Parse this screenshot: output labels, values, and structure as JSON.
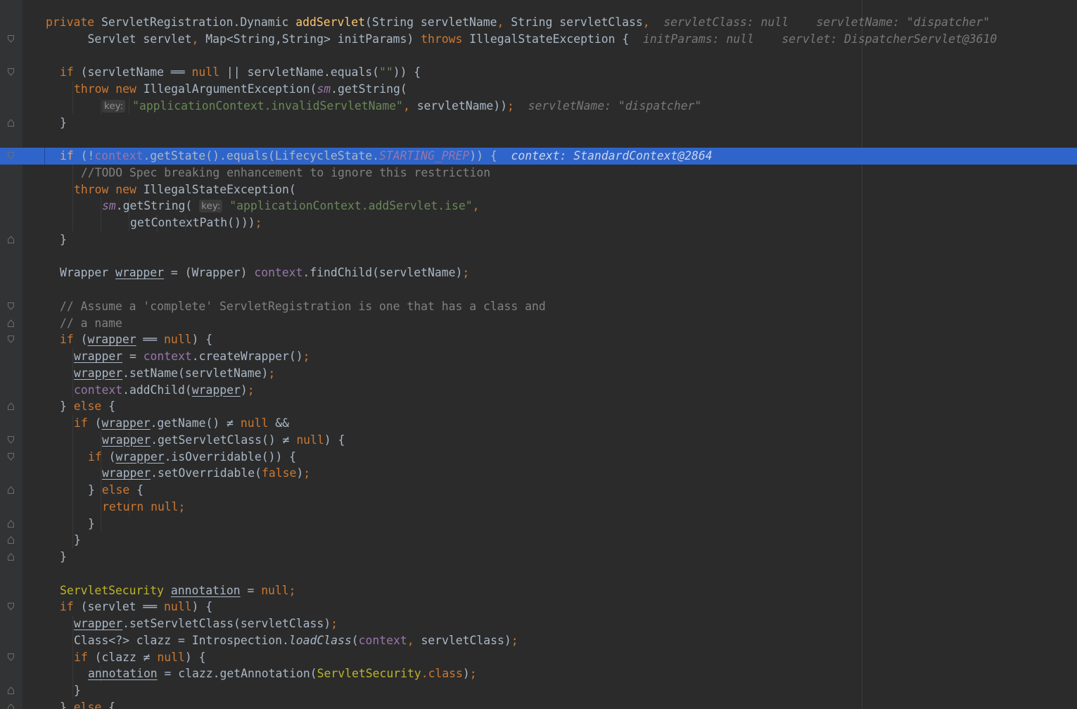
{
  "editor": {
    "language": "java",
    "colors": {
      "background": "#2b2b2b",
      "gutter": "#313335",
      "execution_line": "#2f65ca",
      "keyword": "#cc7832",
      "function": "#ffc66d",
      "string": "#6a8759",
      "field": "#9876aa",
      "comment": "#808080",
      "annotation": "#bbb529",
      "inline_hint": "#787878"
    },
    "icons": {
      "fold_open": "fold-open-icon",
      "fold_close": "fold-close-icon"
    },
    "lines": [
      {
        "indent": 0,
        "fold": "",
        "hl": false,
        "tokens": [
          {
            "t": "private ",
            "c": "kw"
          },
          {
            "t": "ServletRegistration.Dynamic "
          },
          {
            "t": "addServlet",
            "c": "fn"
          },
          {
            "t": "(String servletName"
          },
          {
            "t": ", ",
            "c": "kw"
          },
          {
            "t": "String servletClass"
          },
          {
            "t": ",",
            "c": "kw"
          },
          {
            "t": "  servletClass: null    servletName: \"dispatcher\"",
            "c": "hint"
          }
        ]
      },
      {
        "indent": 1,
        "fold": "open",
        "hl": false,
        "tokens": [
          {
            "t": "    Servlet servlet"
          },
          {
            "t": ", ",
            "c": "kw"
          },
          {
            "t": "Map<String,String> initParams) "
          },
          {
            "t": "throws ",
            "c": "kw"
          },
          {
            "t": "IllegalStateException {"
          },
          {
            "t": "  initParams: null    servlet: DispatcherServlet@3610",
            "c": "hint"
          }
        ]
      },
      {
        "indent": 0,
        "fold": "",
        "hl": false,
        "tokens": []
      },
      {
        "indent": 1,
        "fold": "open",
        "hl": false,
        "tokens": [
          {
            "t": "if ",
            "c": "kw"
          },
          {
            "t": "(servletName ══ "
          },
          {
            "t": "null ",
            "c": "kw"
          },
          {
            "t": "|| servletName.equals("
          },
          {
            "t": "\"\"",
            "c": "str"
          },
          {
            "t": ")) {"
          }
        ]
      },
      {
        "indent": 2,
        "fold": "",
        "hl": false,
        "tokens": [
          {
            "t": "throw new ",
            "c": "kw"
          },
          {
            "t": "IllegalArgumentException("
          },
          {
            "t": "sm",
            "c": "fld it"
          },
          {
            "t": ".getString("
          }
        ]
      },
      {
        "indent": 4,
        "fold": "",
        "hl": false,
        "tokens": [
          {
            "t": "key:",
            "c": "chip"
          },
          {
            "t": " "
          },
          {
            "t": "\"applicationContext.invalidServletName\"",
            "c": "str"
          },
          {
            "t": ", ",
            "c": "kw"
          },
          {
            "t": "servletName))"
          },
          {
            "t": ";",
            "c": "kw"
          },
          {
            "t": "  servletName: \"dispatcher\"",
            "c": "hint"
          }
        ]
      },
      {
        "indent": 1,
        "fold": "close",
        "hl": false,
        "tokens": [
          {
            "t": "}"
          }
        ]
      },
      {
        "indent": 0,
        "fold": "",
        "hl": false,
        "tokens": []
      },
      {
        "indent": 1,
        "fold": "open",
        "hl": true,
        "tokens": [
          {
            "t": "if ",
            "c": "kw"
          },
          {
            "t": "(!"
          },
          {
            "t": "context",
            "c": "fld"
          },
          {
            "t": ".getState().equals(LifecycleState."
          },
          {
            "t": "STARTING_PREP",
            "c": "fld it"
          },
          {
            "t": ")) {"
          },
          {
            "t": "  context: StandardContext@2864",
            "c": "hint"
          }
        ]
      },
      {
        "indent": 2,
        "fold": "",
        "hl": false,
        "tokens": [
          {
            "t": " //TODO Spec breaking enhancement to ignore this restriction",
            "c": "cm"
          }
        ]
      },
      {
        "indent": 2,
        "fold": "",
        "hl": false,
        "tokens": [
          {
            "t": "throw new ",
            "c": "kw"
          },
          {
            "t": "IllegalStateException("
          }
        ]
      },
      {
        "indent": 4,
        "fold": "",
        "hl": false,
        "tokens": [
          {
            "t": "sm",
            "c": "fld it"
          },
          {
            "t": ".getString( "
          },
          {
            "t": "key:",
            "c": "chip"
          },
          {
            "t": " "
          },
          {
            "t": "\"applicationContext.addServlet.ise\"",
            "c": "str"
          },
          {
            "t": ",",
            "c": "kw"
          }
        ]
      },
      {
        "indent": 6,
        "fold": "",
        "hl": false,
        "tokens": [
          {
            "t": "getContextPath()))"
          },
          {
            "t": ";",
            "c": "kw"
          }
        ]
      },
      {
        "indent": 1,
        "fold": "close",
        "hl": false,
        "tokens": [
          {
            "t": "}"
          }
        ]
      },
      {
        "indent": 0,
        "fold": "",
        "hl": false,
        "tokens": []
      },
      {
        "indent": 1,
        "fold": "",
        "hl": false,
        "tokens": [
          {
            "t": "Wrapper "
          },
          {
            "t": "wrapper",
            "c": "ul"
          },
          {
            "t": " = (Wrapper) "
          },
          {
            "t": "context",
            "c": "fld"
          },
          {
            "t": ".findChild(servletName)"
          },
          {
            "t": ";",
            "c": "kw"
          }
        ]
      },
      {
        "indent": 0,
        "fold": "",
        "hl": false,
        "tokens": []
      },
      {
        "indent": 1,
        "fold": "open",
        "hl": false,
        "tokens": [
          {
            "t": "// Assume a 'complete' ServletRegistration is one that has a class and",
            "c": "cm"
          }
        ]
      },
      {
        "indent": 1,
        "fold": "close",
        "hl": false,
        "tokens": [
          {
            "t": "// a name",
            "c": "cm"
          }
        ]
      },
      {
        "indent": 1,
        "fold": "open",
        "hl": false,
        "tokens": [
          {
            "t": "if ",
            "c": "kw"
          },
          {
            "t": "("
          },
          {
            "t": "wrapper",
            "c": "ul"
          },
          {
            "t": " ══ "
          },
          {
            "t": "null",
            "c": "kw"
          },
          {
            "t": ") {"
          }
        ]
      },
      {
        "indent": 2,
        "fold": "",
        "hl": false,
        "tokens": [
          {
            "t": "wrapper",
            "c": "ul"
          },
          {
            "t": " = "
          },
          {
            "t": "context",
            "c": "fld"
          },
          {
            "t": ".createWrapper()"
          },
          {
            "t": ";",
            "c": "kw"
          }
        ]
      },
      {
        "indent": 2,
        "fold": "",
        "hl": false,
        "tokens": [
          {
            "t": "wrapper",
            "c": "ul"
          },
          {
            "t": ".setName(servletName)"
          },
          {
            "t": ";",
            "c": "kw"
          }
        ]
      },
      {
        "indent": 2,
        "fold": "",
        "hl": false,
        "tokens": [
          {
            "t": "context",
            "c": "fld"
          },
          {
            "t": ".addChild("
          },
          {
            "t": "wrapper",
            "c": "ul"
          },
          {
            "t": ")"
          },
          {
            "t": ";",
            "c": "kw"
          }
        ]
      },
      {
        "indent": 1,
        "fold": "close",
        "hl": false,
        "tokens": [
          {
            "t": "} "
          },
          {
            "t": "else ",
            "c": "kw"
          },
          {
            "t": "{"
          }
        ]
      },
      {
        "indent": 2,
        "fold": "",
        "hl": false,
        "tokens": [
          {
            "t": "if ",
            "c": "kw"
          },
          {
            "t": "("
          },
          {
            "t": "wrapper",
            "c": "ul"
          },
          {
            "t": ".getName() ≠ "
          },
          {
            "t": "null ",
            "c": "kw"
          },
          {
            "t": "&&"
          }
        ]
      },
      {
        "indent": 4,
        "fold": "open",
        "hl": false,
        "tokens": [
          {
            "t": "wrapper",
            "c": "ul"
          },
          {
            "t": ".getServletClass() ≠ "
          },
          {
            "t": "null",
            "c": "kw"
          },
          {
            "t": ") {"
          }
        ]
      },
      {
        "indent": 3,
        "fold": "open",
        "hl": false,
        "tokens": [
          {
            "t": "if ",
            "c": "kw"
          },
          {
            "t": "("
          },
          {
            "t": "wrapper",
            "c": "ul"
          },
          {
            "t": ".isOverridable()) {"
          }
        ]
      },
      {
        "indent": 4,
        "fold": "",
        "hl": false,
        "tokens": [
          {
            "t": "wrapper",
            "c": "ul"
          },
          {
            "t": ".setOverridable("
          },
          {
            "t": "false",
            "c": "kw"
          },
          {
            "t": ")"
          },
          {
            "t": ";",
            "c": "kw"
          }
        ]
      },
      {
        "indent": 3,
        "fold": "close",
        "hl": false,
        "tokens": [
          {
            "t": "} "
          },
          {
            "t": "else ",
            "c": "kw"
          },
          {
            "t": "{"
          }
        ]
      },
      {
        "indent": 4,
        "fold": "",
        "hl": false,
        "tokens": [
          {
            "t": "return null;",
            "c": "kw"
          }
        ]
      },
      {
        "indent": 3,
        "fold": "close",
        "hl": false,
        "tokens": [
          {
            "t": "}"
          }
        ]
      },
      {
        "indent": 2,
        "fold": "close",
        "hl": false,
        "tokens": [
          {
            "t": "}"
          }
        ]
      },
      {
        "indent": 1,
        "fold": "close",
        "hl": false,
        "tokens": [
          {
            "t": "}"
          }
        ]
      },
      {
        "indent": 0,
        "fold": "",
        "hl": false,
        "tokens": []
      },
      {
        "indent": 1,
        "fold": "",
        "hl": false,
        "tokens": [
          {
            "t": "ServletSecurity ",
            "c": "ann"
          },
          {
            "t": "annotation",
            "c": "ul"
          },
          {
            "t": " = "
          },
          {
            "t": "null;",
            "c": "kw"
          }
        ]
      },
      {
        "indent": 1,
        "fold": "open",
        "hl": false,
        "tokens": [
          {
            "t": "if ",
            "c": "kw"
          },
          {
            "t": "(servlet ══ "
          },
          {
            "t": "null",
            "c": "kw"
          },
          {
            "t": ") {"
          }
        ]
      },
      {
        "indent": 2,
        "fold": "",
        "hl": false,
        "tokens": [
          {
            "t": "wrapper",
            "c": "ul"
          },
          {
            "t": ".setServletClass(servletClass)"
          },
          {
            "t": ";",
            "c": "kw"
          }
        ]
      },
      {
        "indent": 2,
        "fold": "",
        "hl": false,
        "tokens": [
          {
            "t": "Class<?> clazz = Introspection."
          },
          {
            "t": "loadClass",
            "c": "it"
          },
          {
            "t": "("
          },
          {
            "t": "context",
            "c": "fld"
          },
          {
            "t": ", ",
            "c": "kw"
          },
          {
            "t": "servletClass)"
          },
          {
            "t": ";",
            "c": "kw"
          }
        ]
      },
      {
        "indent": 2,
        "fold": "open",
        "hl": false,
        "tokens": [
          {
            "t": "if ",
            "c": "kw"
          },
          {
            "t": "(clazz ≠ "
          },
          {
            "t": "null",
            "c": "kw"
          },
          {
            "t": ") {"
          }
        ]
      },
      {
        "indent": 3,
        "fold": "",
        "hl": false,
        "tokens": [
          {
            "t": "annotation",
            "c": "ul"
          },
          {
            "t": " = clazz.getAnnotation("
          },
          {
            "t": "ServletSecurity",
            "c": "ann"
          },
          {
            "t": ".",
            "c": "kw"
          },
          {
            "t": "class",
            "c": "kw"
          },
          {
            "t": ")"
          },
          {
            "t": ";",
            "c": "kw"
          }
        ]
      },
      {
        "indent": 2,
        "fold": "close",
        "hl": false,
        "tokens": [
          {
            "t": "}"
          }
        ]
      },
      {
        "indent": 1,
        "fold": "close",
        "hl": false,
        "tokens": [
          {
            "t": "} "
          },
          {
            "t": "else ",
            "c": "kw"
          },
          {
            "t": "{"
          }
        ]
      }
    ]
  }
}
